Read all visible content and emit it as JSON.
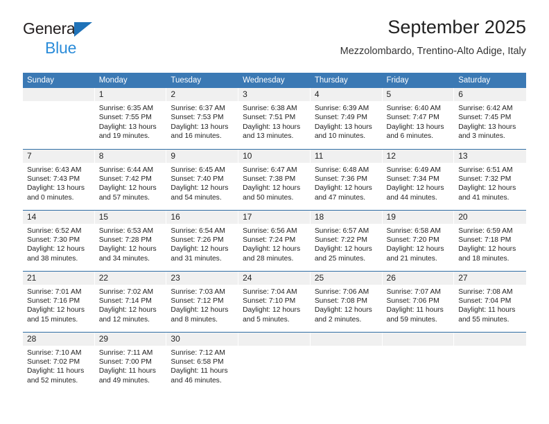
{
  "brand": {
    "line1": "General",
    "line2": "Blue",
    "triangle_icon": "triangle-icon",
    "blue": "#2b8cd9",
    "dark": "#231f20"
  },
  "header": {
    "title": "September 2025",
    "location": "Mezzolombardo, Trentino-Alto Adige, Italy"
  },
  "colors": {
    "header_blue": "#3b79b4",
    "row_rule_blue": "#2e6da4",
    "daynum_band": "#f0f0f0"
  },
  "weekday_headers": [
    "Sunday",
    "Monday",
    "Tuesday",
    "Wednesday",
    "Thursday",
    "Friday",
    "Saturday"
  ],
  "weeks": [
    [
      {
        "day": "",
        "sunrise": "",
        "sunset": "",
        "daylight_1": "",
        "daylight_2": ""
      },
      {
        "day": "1",
        "sunrise": "Sunrise: 6:35 AM",
        "sunset": "Sunset: 7:55 PM",
        "daylight_1": "Daylight: 13 hours",
        "daylight_2": "and 19 minutes."
      },
      {
        "day": "2",
        "sunrise": "Sunrise: 6:37 AM",
        "sunset": "Sunset: 7:53 PM",
        "daylight_1": "Daylight: 13 hours",
        "daylight_2": "and 16 minutes."
      },
      {
        "day": "3",
        "sunrise": "Sunrise: 6:38 AM",
        "sunset": "Sunset: 7:51 PM",
        "daylight_1": "Daylight: 13 hours",
        "daylight_2": "and 13 minutes."
      },
      {
        "day": "4",
        "sunrise": "Sunrise: 6:39 AM",
        "sunset": "Sunset: 7:49 PM",
        "daylight_1": "Daylight: 13 hours",
        "daylight_2": "and 10 minutes."
      },
      {
        "day": "5",
        "sunrise": "Sunrise: 6:40 AM",
        "sunset": "Sunset: 7:47 PM",
        "daylight_1": "Daylight: 13 hours",
        "daylight_2": "and 6 minutes."
      },
      {
        "day": "6",
        "sunrise": "Sunrise: 6:42 AM",
        "sunset": "Sunset: 7:45 PM",
        "daylight_1": "Daylight: 13 hours",
        "daylight_2": "and 3 minutes."
      }
    ],
    [
      {
        "day": "7",
        "sunrise": "Sunrise: 6:43 AM",
        "sunset": "Sunset: 7:43 PM",
        "daylight_1": "Daylight: 13 hours",
        "daylight_2": "and 0 minutes."
      },
      {
        "day": "8",
        "sunrise": "Sunrise: 6:44 AM",
        "sunset": "Sunset: 7:42 PM",
        "daylight_1": "Daylight: 12 hours",
        "daylight_2": "and 57 minutes."
      },
      {
        "day": "9",
        "sunrise": "Sunrise: 6:45 AM",
        "sunset": "Sunset: 7:40 PM",
        "daylight_1": "Daylight: 12 hours",
        "daylight_2": "and 54 minutes."
      },
      {
        "day": "10",
        "sunrise": "Sunrise: 6:47 AM",
        "sunset": "Sunset: 7:38 PM",
        "daylight_1": "Daylight: 12 hours",
        "daylight_2": "and 50 minutes."
      },
      {
        "day": "11",
        "sunrise": "Sunrise: 6:48 AM",
        "sunset": "Sunset: 7:36 PM",
        "daylight_1": "Daylight: 12 hours",
        "daylight_2": "and 47 minutes."
      },
      {
        "day": "12",
        "sunrise": "Sunrise: 6:49 AM",
        "sunset": "Sunset: 7:34 PM",
        "daylight_1": "Daylight: 12 hours",
        "daylight_2": "and 44 minutes."
      },
      {
        "day": "13",
        "sunrise": "Sunrise: 6:51 AM",
        "sunset": "Sunset: 7:32 PM",
        "daylight_1": "Daylight: 12 hours",
        "daylight_2": "and 41 minutes."
      }
    ],
    [
      {
        "day": "14",
        "sunrise": "Sunrise: 6:52 AM",
        "sunset": "Sunset: 7:30 PM",
        "daylight_1": "Daylight: 12 hours",
        "daylight_2": "and 38 minutes."
      },
      {
        "day": "15",
        "sunrise": "Sunrise: 6:53 AM",
        "sunset": "Sunset: 7:28 PM",
        "daylight_1": "Daylight: 12 hours",
        "daylight_2": "and 34 minutes."
      },
      {
        "day": "16",
        "sunrise": "Sunrise: 6:54 AM",
        "sunset": "Sunset: 7:26 PM",
        "daylight_1": "Daylight: 12 hours",
        "daylight_2": "and 31 minutes."
      },
      {
        "day": "17",
        "sunrise": "Sunrise: 6:56 AM",
        "sunset": "Sunset: 7:24 PM",
        "daylight_1": "Daylight: 12 hours",
        "daylight_2": "and 28 minutes."
      },
      {
        "day": "18",
        "sunrise": "Sunrise: 6:57 AM",
        "sunset": "Sunset: 7:22 PM",
        "daylight_1": "Daylight: 12 hours",
        "daylight_2": "and 25 minutes."
      },
      {
        "day": "19",
        "sunrise": "Sunrise: 6:58 AM",
        "sunset": "Sunset: 7:20 PM",
        "daylight_1": "Daylight: 12 hours",
        "daylight_2": "and 21 minutes."
      },
      {
        "day": "20",
        "sunrise": "Sunrise: 6:59 AM",
        "sunset": "Sunset: 7:18 PM",
        "daylight_1": "Daylight: 12 hours",
        "daylight_2": "and 18 minutes."
      }
    ],
    [
      {
        "day": "21",
        "sunrise": "Sunrise: 7:01 AM",
        "sunset": "Sunset: 7:16 PM",
        "daylight_1": "Daylight: 12 hours",
        "daylight_2": "and 15 minutes."
      },
      {
        "day": "22",
        "sunrise": "Sunrise: 7:02 AM",
        "sunset": "Sunset: 7:14 PM",
        "daylight_1": "Daylight: 12 hours",
        "daylight_2": "and 12 minutes."
      },
      {
        "day": "23",
        "sunrise": "Sunrise: 7:03 AM",
        "sunset": "Sunset: 7:12 PM",
        "daylight_1": "Daylight: 12 hours",
        "daylight_2": "and 8 minutes."
      },
      {
        "day": "24",
        "sunrise": "Sunrise: 7:04 AM",
        "sunset": "Sunset: 7:10 PM",
        "daylight_1": "Daylight: 12 hours",
        "daylight_2": "and 5 minutes."
      },
      {
        "day": "25",
        "sunrise": "Sunrise: 7:06 AM",
        "sunset": "Sunset: 7:08 PM",
        "daylight_1": "Daylight: 12 hours",
        "daylight_2": "and 2 minutes."
      },
      {
        "day": "26",
        "sunrise": "Sunrise: 7:07 AM",
        "sunset": "Sunset: 7:06 PM",
        "daylight_1": "Daylight: 11 hours",
        "daylight_2": "and 59 minutes."
      },
      {
        "day": "27",
        "sunrise": "Sunrise: 7:08 AM",
        "sunset": "Sunset: 7:04 PM",
        "daylight_1": "Daylight: 11 hours",
        "daylight_2": "and 55 minutes."
      }
    ],
    [
      {
        "day": "28",
        "sunrise": "Sunrise: 7:10 AM",
        "sunset": "Sunset: 7:02 PM",
        "daylight_1": "Daylight: 11 hours",
        "daylight_2": "and 52 minutes."
      },
      {
        "day": "29",
        "sunrise": "Sunrise: 7:11 AM",
        "sunset": "Sunset: 7:00 PM",
        "daylight_1": "Daylight: 11 hours",
        "daylight_2": "and 49 minutes."
      },
      {
        "day": "30",
        "sunrise": "Sunrise: 7:12 AM",
        "sunset": "Sunset: 6:58 PM",
        "daylight_1": "Daylight: 11 hours",
        "daylight_2": "and 46 minutes."
      },
      {
        "day": "",
        "sunrise": "",
        "sunset": "",
        "daylight_1": "",
        "daylight_2": ""
      },
      {
        "day": "",
        "sunrise": "",
        "sunset": "",
        "daylight_1": "",
        "daylight_2": ""
      },
      {
        "day": "",
        "sunrise": "",
        "sunset": "",
        "daylight_1": "",
        "daylight_2": ""
      },
      {
        "day": "",
        "sunrise": "",
        "sunset": "",
        "daylight_1": "",
        "daylight_2": ""
      }
    ]
  ]
}
